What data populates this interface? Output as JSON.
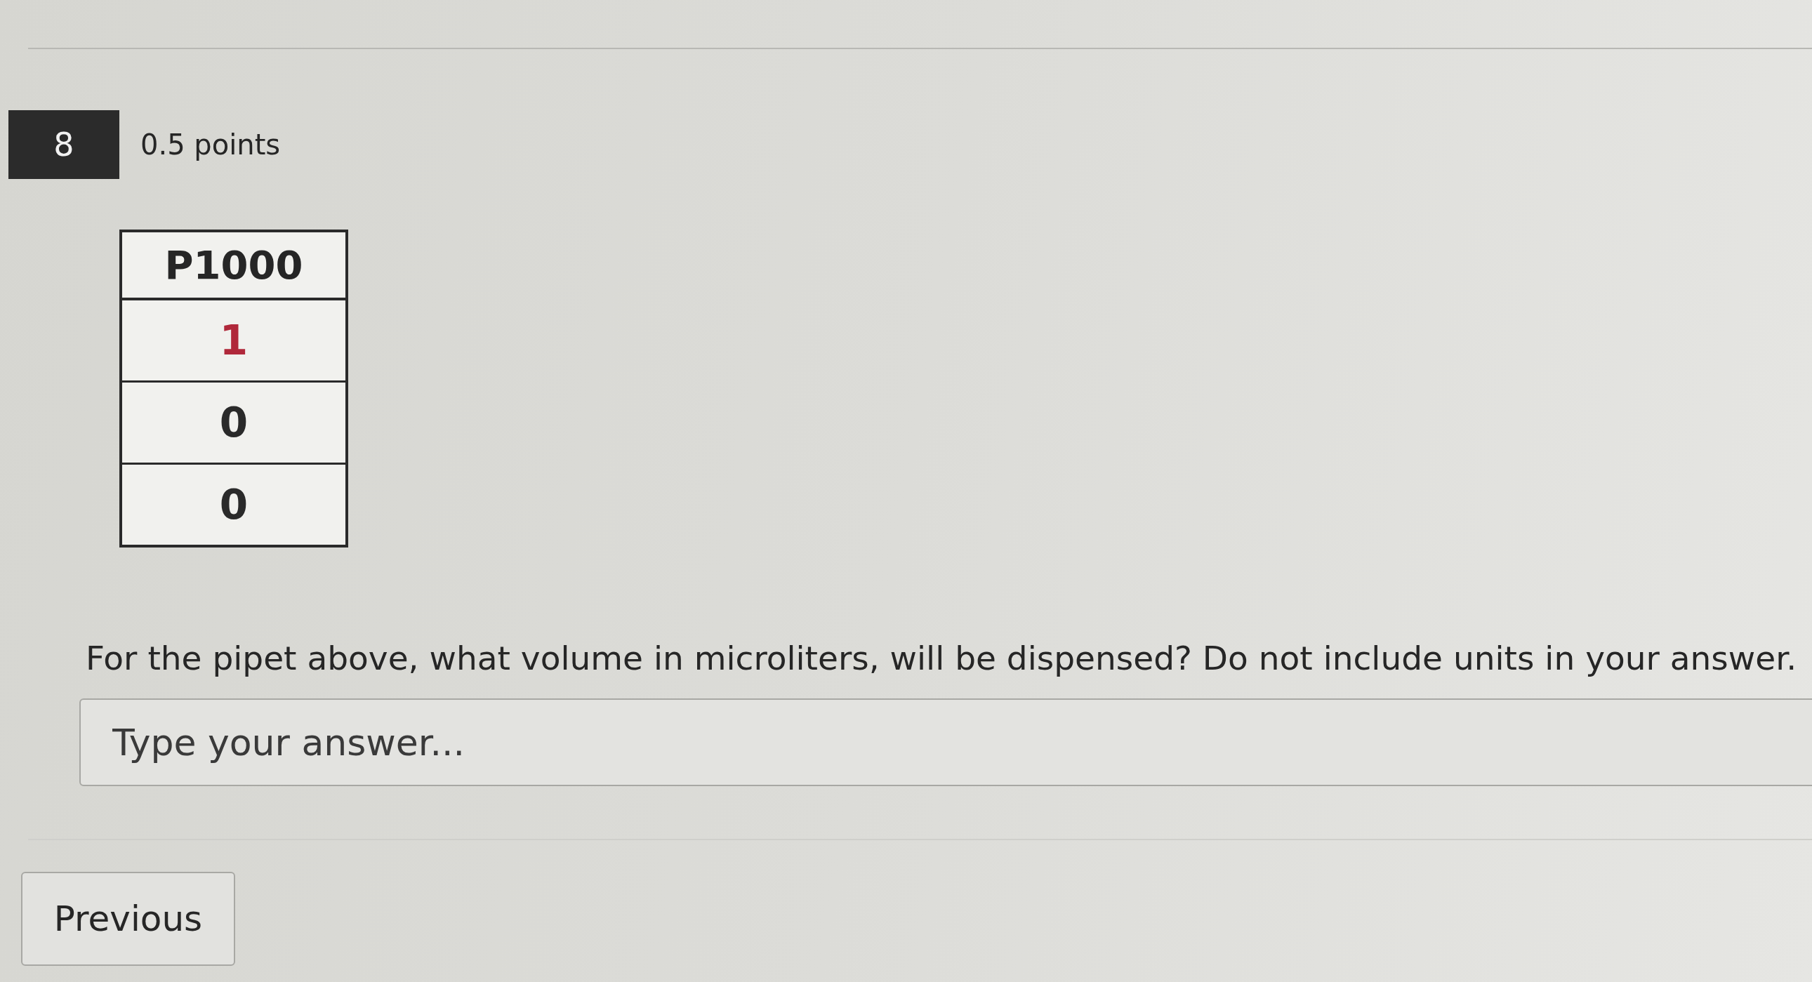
{
  "question": {
    "number": "8",
    "points": "0.5 points",
    "pipet_display": {
      "model": "P1000",
      "digits": [
        {
          "text": "1",
          "color": "#b0283a"
        },
        {
          "text": "0",
          "color": "#2a2a2a"
        },
        {
          "text": "0",
          "color": "#2a2a2a"
        }
      ]
    },
    "prompt": "For the pipet above, what volume in microliters, will be dispensed?  Do not include units in your answer.",
    "answer": {
      "placeholder": "Type your answer..."
    }
  },
  "navigation": {
    "previous": "Previous"
  }
}
